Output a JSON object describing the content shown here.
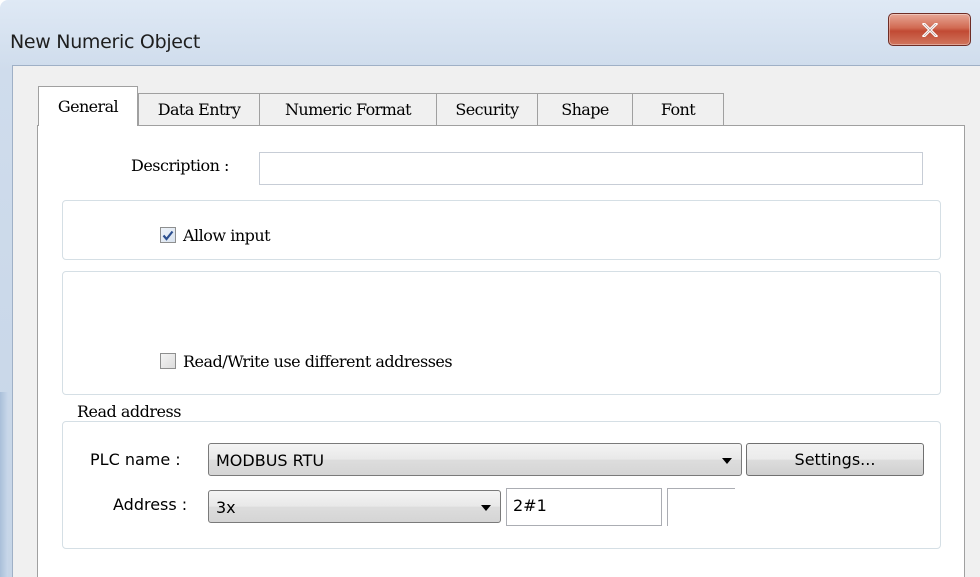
{
  "window": {
    "title": "New Numeric Object",
    "close_icon": "close-icon"
  },
  "tabs": [
    {
      "label": "General",
      "active": true
    },
    {
      "label": "Data Entry",
      "active": false
    },
    {
      "label": "Numeric Format",
      "active": false
    },
    {
      "label": "Security",
      "active": false
    },
    {
      "label": "Shape",
      "active": false
    },
    {
      "label": "Font",
      "active": false
    }
  ],
  "general": {
    "description_label": "Description :",
    "description_value": "",
    "allow_input_label": "Allow input",
    "allow_input_checked": true,
    "rw_diff_label": "Read/Write use different addresses",
    "rw_diff_checked": false,
    "read_address": {
      "legend": "Read address",
      "plc_name_label": "PLC name :",
      "plc_name_value": "MODBUS RTU",
      "settings_label": "Settings...",
      "address_label": "Address :",
      "address_type_value": "3x",
      "address_value": "2#1"
    }
  },
  "colors": {
    "close_button": "#c9533c",
    "tab_border": "#a0a0a0",
    "window_frame": "#cfdcec"
  }
}
